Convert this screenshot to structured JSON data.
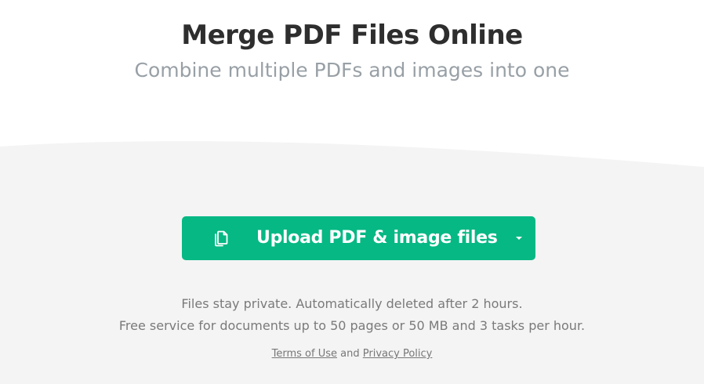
{
  "header": {
    "title": "Merge PDF Files Online",
    "subtitle": "Combine multiple PDFs and images into one"
  },
  "upload": {
    "icon": "copy-files-icon",
    "label": "Upload PDF & image files",
    "dropdown_icon": "chevron-down-icon",
    "color": "#06b884"
  },
  "info": {
    "privacy": "Files stay private. Automatically deleted after 2 hours.",
    "limits": "Free service for documents up to 50 pages or 50 MB and 3 tasks per hour."
  },
  "legal": {
    "terms_label": "Terms of Use",
    "conjunction": "and",
    "privacy_label": "Privacy Policy"
  },
  "colors": {
    "background_band": "#f4f4f4",
    "title": "#2e2e2e",
    "subtitle": "#98a0a6"
  }
}
